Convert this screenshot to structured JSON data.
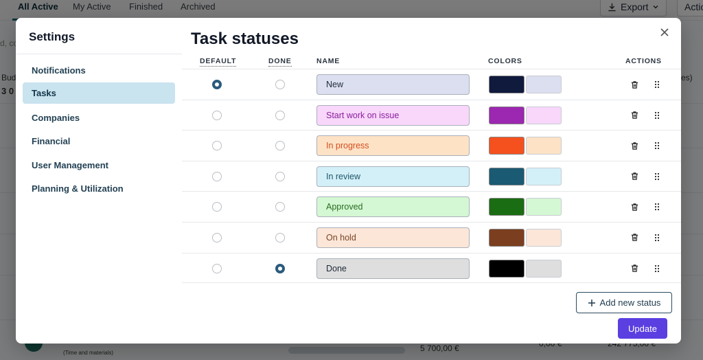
{
  "background": {
    "tabs": [
      "All Active",
      "My Active",
      "Finished",
      "Archived"
    ],
    "export_label": "Export",
    "actions_fragment": "Actio",
    "search_fragment": "d, co",
    "budget_fragment": "Bud",
    "value_fragment": "3 0",
    "right_fragment": "es)",
    "footer_fragments": [
      "(Time and materials)",
      "5 700,00 €",
      "0,00 €",
      "242 775,00 €"
    ]
  },
  "settings": {
    "title": "Settings",
    "nav": [
      {
        "label": "Notifications",
        "active": false
      },
      {
        "label": "Tasks",
        "active": true
      },
      {
        "label": "Companies",
        "active": false
      },
      {
        "label": "Financial",
        "active": false
      },
      {
        "label": "User Management",
        "active": false
      },
      {
        "label": "Planning & Utilization",
        "active": false
      }
    ]
  },
  "task_statuses": {
    "title": "Task statuses",
    "columns": {
      "default": "DEFAULT",
      "done": "DONE",
      "name": "NAME",
      "colors": "COLORS",
      "actions": "ACTIONS"
    },
    "statuses": [
      {
        "name": "New",
        "default": true,
        "done": false,
        "color": "#0f1a3d",
        "light": "#dbdff0",
        "text": "#1f2937"
      },
      {
        "name": "Start work on issue",
        "default": false,
        "done": false,
        "color": "#9c27b0",
        "light": "#f8d7fb",
        "text": "#8a1f9c"
      },
      {
        "name": "In progress",
        "default": false,
        "done": false,
        "color": "#f4511e",
        "light": "#fde2c6",
        "text": "#d5501e"
      },
      {
        "name": "In review",
        "default": false,
        "done": false,
        "color": "#1a5a73",
        "light": "#d3f0f8",
        "text": "#1e5668"
      },
      {
        "name": "Approved",
        "default": false,
        "done": false,
        "color": "#1b6d13",
        "light": "#d4f8d3",
        "text": "#2a6d22"
      },
      {
        "name": "On hold",
        "default": false,
        "done": false,
        "color": "#7b3f1f",
        "light": "#fbe6d8",
        "text": "#7a4424"
      },
      {
        "name": "Done",
        "default": false,
        "done": true,
        "color": "#000000",
        "light": "#dedede",
        "text": "#1f2937"
      }
    ],
    "add_label": "Add new status",
    "update_label": "Update"
  }
}
